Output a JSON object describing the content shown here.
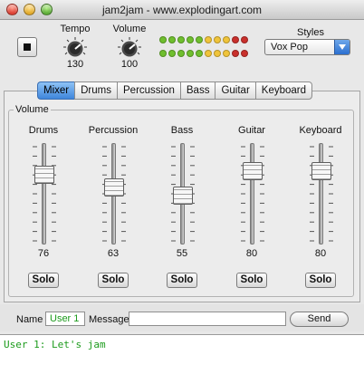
{
  "window": {
    "title": "jam2jam - www.explodingart.com"
  },
  "transport": {
    "stop_icon": "stop-icon"
  },
  "knobs": {
    "tempo": {
      "label": "Tempo",
      "value": "130"
    },
    "volume": {
      "label": "Volume",
      "value": "100"
    }
  },
  "level_meter": {
    "rows": [
      [
        "#6fbf2e",
        "#6fbf2e",
        "#6fbf2e",
        "#6fbf2e",
        "#6fbf2e",
        "#f0c43a",
        "#f0c43a",
        "#f0c43a",
        "#c9302c",
        "#c9302c"
      ],
      [
        "#6fbf2e",
        "#6fbf2e",
        "#6fbf2e",
        "#6fbf2e",
        "#6fbf2e",
        "#f0c43a",
        "#f0c43a",
        "#f0c43a",
        "#c9302c",
        "#c9302c"
      ]
    ]
  },
  "styles": {
    "label": "Styles",
    "selected": "Vox Pop"
  },
  "tabs": [
    {
      "label": "Mixer",
      "active": true
    },
    {
      "label": "Drums",
      "active": false
    },
    {
      "label": "Percussion",
      "active": false
    },
    {
      "label": "Bass",
      "active": false
    },
    {
      "label": "Guitar",
      "active": false
    },
    {
      "label": "Keyboard",
      "active": false
    }
  ],
  "mixer": {
    "group_title": "Volume",
    "channels": [
      {
        "label": "Drums",
        "value": "76",
        "level": 76,
        "solo_label": "Solo"
      },
      {
        "label": "Percussion",
        "value": "63",
        "level": 63,
        "solo_label": "Solo"
      },
      {
        "label": "Bass",
        "value": "55",
        "level": 55,
        "solo_label": "Solo"
      },
      {
        "label": "Guitar",
        "value": "80",
        "level": 80,
        "solo_label": "Solo"
      },
      {
        "label": "Keyboard",
        "value": "80",
        "level": 80,
        "solo_label": "Solo"
      }
    ]
  },
  "chat": {
    "name_label": "Name",
    "name_value": "User 1",
    "message_label": "Message",
    "message_value": "",
    "send_label": "Send",
    "log": "User 1: Let's jam"
  },
  "colors": {
    "accent": "#3f86dc",
    "chat_text": "#1c9b1c"
  }
}
